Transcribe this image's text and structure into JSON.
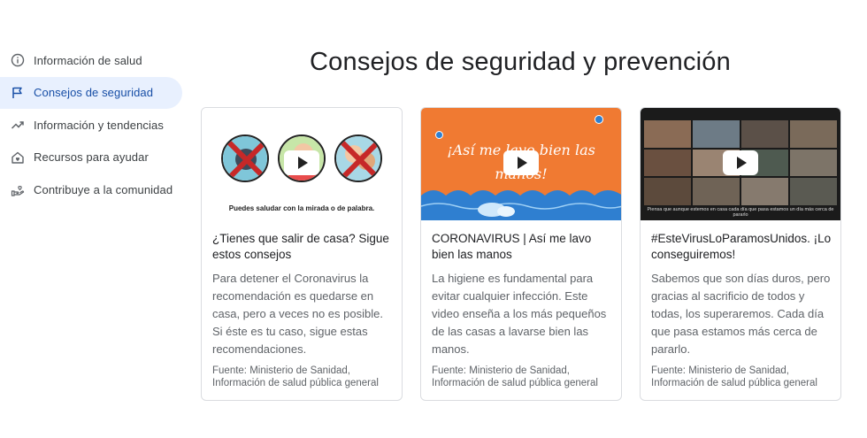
{
  "sidebar": {
    "items": [
      {
        "label": "Información de salud",
        "icon": "info-icon",
        "active": false
      },
      {
        "label": "Consejos de seguridad",
        "icon": "flag-icon",
        "active": true
      },
      {
        "label": "Información y tendencias",
        "icon": "trending-up-icon",
        "active": false
      },
      {
        "label": "Recursos para ayudar",
        "icon": "home-heart-icon",
        "active": false
      },
      {
        "label": "Contribuye a la comunidad",
        "icon": "volunteer-hand-icon",
        "active": false
      }
    ]
  },
  "main": {
    "title": "Consejos de seguridad y prevención",
    "cards": [
      {
        "thumb_caption": "Puedes saludar con la mirada o de palabra.",
        "title": "¿Tienes que salir de casa? Sigue estos consejos",
        "description": "Para detener el Coronavirus la recomendación es quedarse en casa, pero a veces no es posible. Si éste es tu caso, sigue estas recomendaciones.",
        "source": "Fuente: Ministerio de Sanidad, Información de salud pública general"
      },
      {
        "thumb_caption": "¡Así me lavo bien las manos!",
        "title": "CORONAVIRUS | Así me lavo bien las manos",
        "description": "La higiene es fundamental para evitar cualquier infección. Este video enseña a los más pequeños de las casas a lavarse bien las manos.",
        "source": "Fuente: Ministerio de Sanidad, Información de salud pública general"
      },
      {
        "thumb_caption": "Piensa que aunque estemos en casa cada día que pasa estamos un día más cerca de pararlo",
        "title": "#EsteVirusLoParamosUnidos. ¡Lo conseguiremos!",
        "description": "Sabemos que son días duros, pero gracias al sacrificio de todos y todas, los superaremos. Cada día que pasa estamos más cerca de pararlo.",
        "source": "Fuente: Ministerio de Sanidad, Información de salud pública general"
      }
    ]
  },
  "colors": {
    "active_bg": "#e8f0fe",
    "active_text": "#174ea6",
    "thumb2_orange": "#f07a32",
    "thumb2_blue": "#2f7fd0"
  }
}
